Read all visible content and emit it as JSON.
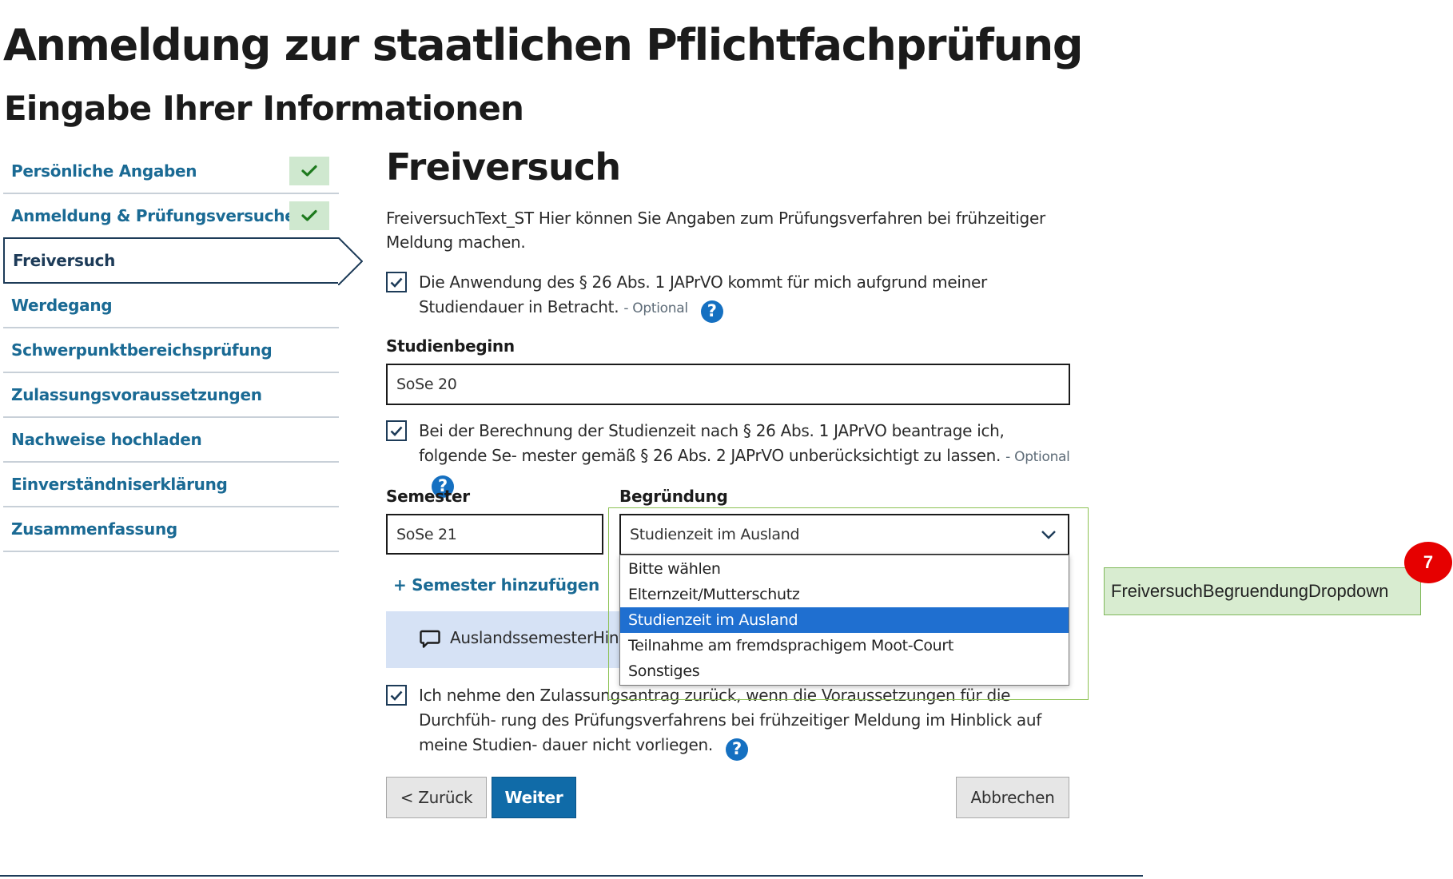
{
  "page": {
    "title": "Anmeldung zur staatlichen Pflichtfachprüfung",
    "subtitle": "Eingabe Ihrer Informationen"
  },
  "sidebar": {
    "items": [
      {
        "label": "Persönliche Angaben",
        "state": "done"
      },
      {
        "label": "Anmeldung & Prüfungsversuche",
        "state": "done"
      },
      {
        "label": "Freiversuch",
        "state": "active"
      },
      {
        "label": "Werdegang",
        "state": "todo"
      },
      {
        "label": "Schwerpunktbereichsprüfung",
        "state": "todo"
      },
      {
        "label": "Zulassungsvoraussetzungen",
        "state": "todo"
      },
      {
        "label": "Nachweise hochladen",
        "state": "todo"
      },
      {
        "label": "Einverständniserklärung",
        "state": "todo"
      },
      {
        "label": "Zusammenfassung",
        "state": "todo"
      }
    ],
    "check_icon": "check-icon"
  },
  "main": {
    "section_title": "Freiversuch",
    "intro_text": "FreiversuchText_ST Hier können Sie Angaben zum Prüfungsverfahren bei frühzeitiger Meldung machen.",
    "checkbox1": {
      "checked": true,
      "text": "Die Anwendung des § 26 Abs. 1 JAPrVO kommt für mich aufgrund meiner Studiendauer in Betracht.",
      "optional": "- Optional"
    },
    "studienbeginn": {
      "label": "Studienbeginn",
      "value": "SoSe 20"
    },
    "checkbox2": {
      "checked": true,
      "text": "Bei der Berechnung der Studienzeit nach § 26 Abs. 1 JAPrVO beantrage ich, folgende Se- mester gemäß § 26 Abs. 2 JAPrVO unberücksichtigt zu lassen.",
      "optional": "- Optional"
    },
    "semester": {
      "label": "Semester",
      "value": "SoSe 21"
    },
    "begruendung": {
      "label": "Begründung",
      "value": "Studienzeit im Ausland",
      "options": [
        "Bitte wählen",
        "Elternzeit/Mutterschutz",
        "Studienzeit im Ausland",
        "Teilnahme am fremdsprachigem Moot-Court",
        "Sonstiges"
      ],
      "selected_index": 2
    },
    "add_semester": "+ Semester hinzufügen",
    "info_text": "AuslandssemesterHinw",
    "checkbox3": {
      "checked": true,
      "text": "Ich nehme den Zulassungsantrag zurück, wenn die Voraussetzungen für die Durchfüh- rung des Prüfungsverfahrens bei frühzeitiger Meldung im Hinblick auf meine Studien- dauer nicht vorliegen."
    },
    "help_glyph": "?",
    "buttons": {
      "back": "< Zurück",
      "next": "Weiter",
      "cancel": "Abbrechen"
    }
  },
  "annotation": {
    "label": "FreiversuchBegruendungDropdown",
    "number": "7"
  },
  "colors": {
    "link": "#1a6a94",
    "primary": "#106ba8",
    "help": "#1570c1",
    "check_bg": "#cfe8cf",
    "info_bg": "#d6e2f5",
    "highlight": "#8cc152",
    "badge": "#e60000",
    "selected_option": "#1f6fd0"
  }
}
